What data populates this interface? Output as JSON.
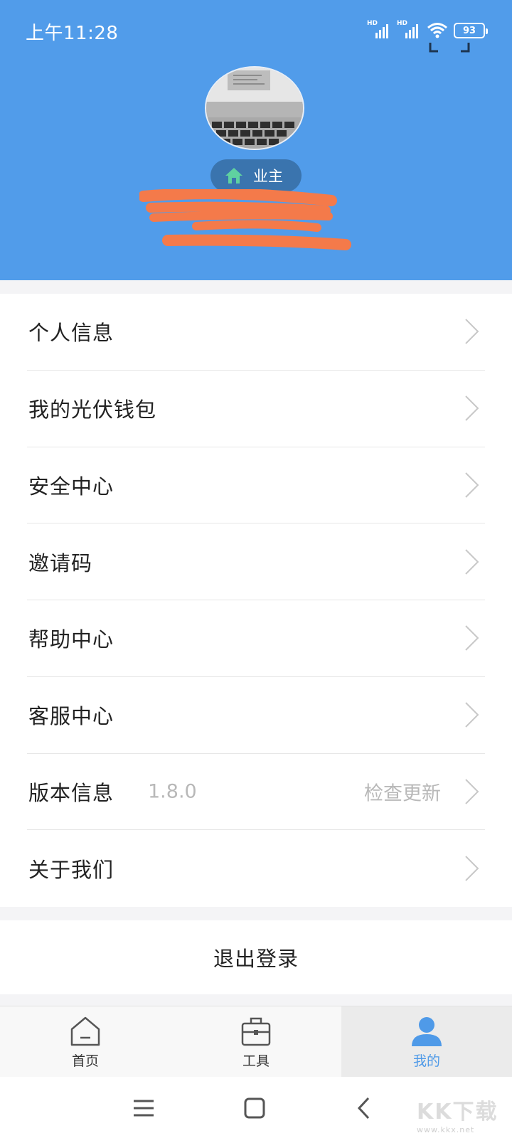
{
  "status_bar": {
    "time": "上午11:28",
    "signal_1": "HD",
    "signal_2": "HD",
    "battery": "93",
    "icons": [
      "signal-icon",
      "signal-icon",
      "wifi-icon",
      "battery-icon"
    ]
  },
  "header": {
    "background": "#519cea",
    "role_label": "业主",
    "role_icon": "home-icon"
  },
  "menu": {
    "items": [
      {
        "label": "个人信息"
      },
      {
        "label": "我的光伏钱包"
      },
      {
        "label": "安全中心"
      },
      {
        "label": "邀请码"
      },
      {
        "label": "帮助中心"
      },
      {
        "label": "客服中心"
      },
      {
        "label": "版本信息",
        "version": "1.8.0",
        "aside": "检查更新"
      },
      {
        "label": "关于我们"
      }
    ]
  },
  "logout": {
    "label": "退出登录"
  },
  "tabbar": {
    "tabs": [
      {
        "label": "首页",
        "icon": "home-icon",
        "active": false
      },
      {
        "label": "工具",
        "icon": "toolbox-icon",
        "active": false
      },
      {
        "label": "我的",
        "icon": "user-icon",
        "active": true
      }
    ],
    "active_color": "#4f9ae8"
  },
  "watermark": {
    "logo": "KK下载",
    "url": "www.kkx.net"
  }
}
